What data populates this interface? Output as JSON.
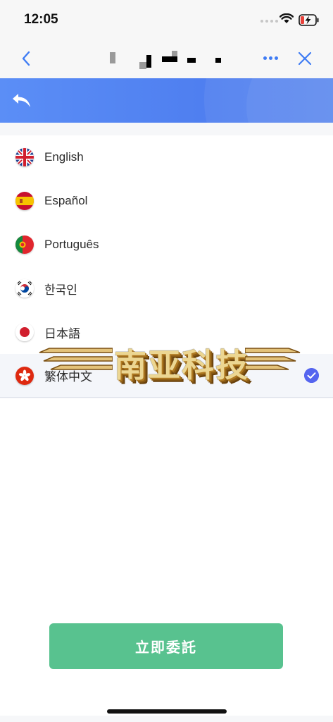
{
  "status_bar": {
    "time": "12:05"
  },
  "languages": [
    {
      "label": "English",
      "flag": "uk-flag-icon",
      "selected": false
    },
    {
      "label": "Español",
      "flag": "spain-flag-icon",
      "selected": false
    },
    {
      "label": "Português",
      "flag": "portugal-flag-icon",
      "selected": false
    },
    {
      "label": "한국인",
      "flag": "korea-flag-icon",
      "selected": false
    },
    {
      "label": "日本語",
      "flag": "japan-flag-icon",
      "selected": false
    },
    {
      "label": "繁体中文",
      "flag": "hongkong-flag-icon",
      "selected": true
    }
  ],
  "watermark": {
    "text": "南亚科技"
  },
  "footer": {
    "button_label": "立即委託"
  },
  "colors": {
    "accent": "#3f7cf4",
    "banner": "#5b8ef6",
    "button": "#58c28f",
    "check": "#5565ef"
  }
}
